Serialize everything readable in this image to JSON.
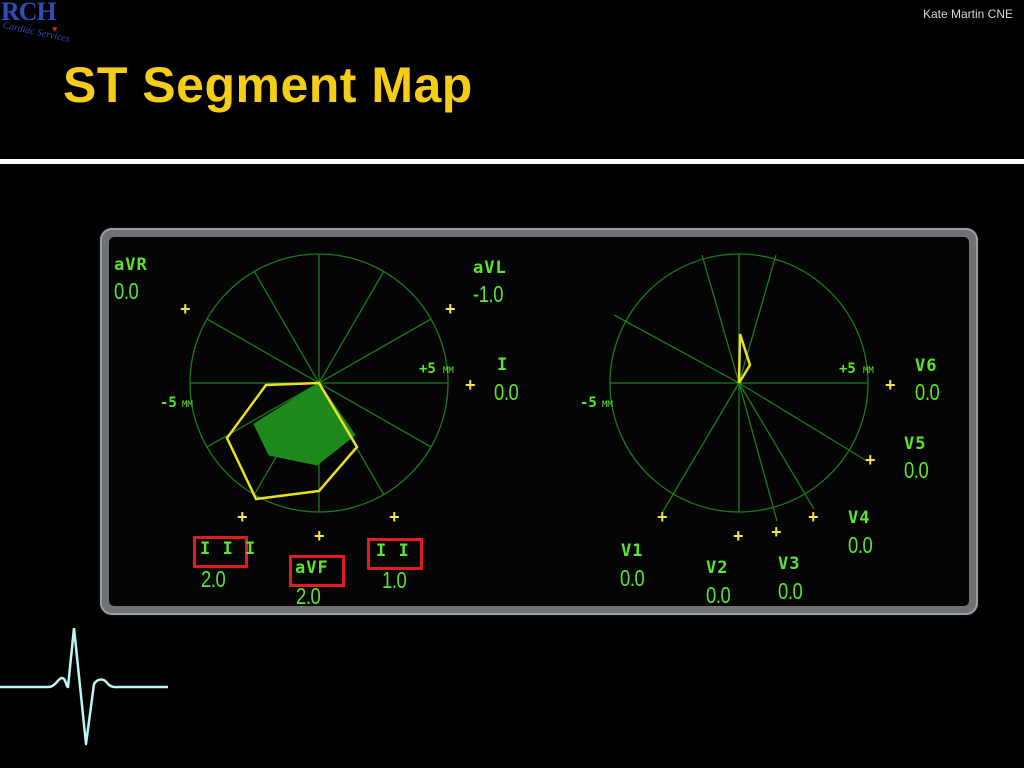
{
  "slide": {
    "logo": {
      "main": "RCH",
      "sub": "Cardiac Services"
    },
    "author": "Kate Martin CNE",
    "title": "ST Segment Map"
  },
  "monitor": {
    "limb_map": {
      "scale_minus": "-5",
      "scale_plus": "+5",
      "unit": "MM",
      "leads": {
        "aVR": {
          "name": "aVR",
          "value": "0.0"
        },
        "aVL": {
          "name": "aVL",
          "value": "-1.0"
        },
        "I": {
          "name": "I",
          "value": "0.0"
        },
        "II": {
          "name": "I I",
          "value": "1.0"
        },
        "aVF": {
          "name": "aVF",
          "value": "2.0"
        },
        "III": {
          "name": "I I I",
          "value": "2.0"
        }
      }
    },
    "chest_map": {
      "scale_minus": "-5",
      "scale_plus": "+5",
      "unit": "MM",
      "leads": {
        "V1": {
          "name": "V1",
          "value": "0.0"
        },
        "V2": {
          "name": "V2",
          "value": "0.0"
        },
        "V3": {
          "name": "V3",
          "value": "0.0"
        },
        "V4": {
          "name": "V4",
          "value": "0.0"
        },
        "V5": {
          "name": "V5",
          "value": "0.0"
        },
        "V6": {
          "name": "V6",
          "value": "0.0"
        }
      }
    },
    "colors": {
      "grid": "#1f7a1f",
      "text": "#5de62b",
      "marker": "#f4e545",
      "polygon": "#e8e21e",
      "fill": "#1e8a1e",
      "highlight": "#e31d1d"
    }
  }
}
